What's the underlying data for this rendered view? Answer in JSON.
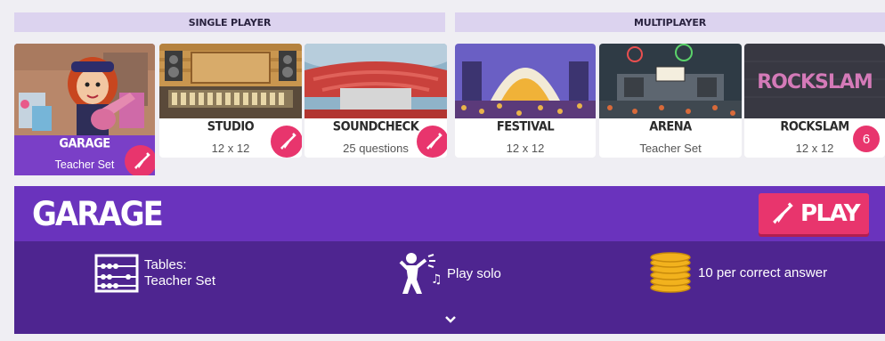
{
  "sections": {
    "single_player": "SINGLE PLAYER",
    "multiplayer": "MULTIPLAYER"
  },
  "cards": {
    "garage": {
      "title": "GARAGE",
      "subtitle": "Teacher Set",
      "icon": "guitar-icon"
    },
    "studio": {
      "title": "STUDIO",
      "subtitle": "12 x 12",
      "icon": "guitar-icon"
    },
    "soundcheck": {
      "title": "SOUNDCHECK",
      "subtitle": "25 questions",
      "icon": "guitar-icon"
    },
    "festival": {
      "title": "FESTIVAL",
      "subtitle": "12 x 12"
    },
    "arena": {
      "title": "ARENA",
      "subtitle": "Teacher Set"
    },
    "rockslam": {
      "title": "ROCKSLAM",
      "subtitle": "12 x 12",
      "badge": "6"
    }
  },
  "rockslam_logo": "ROCKSLAM",
  "banner": {
    "title": "GARAGE",
    "play_label": "PLAY"
  },
  "info": {
    "tables_label": "Tables:",
    "tables_value": "Teacher Set",
    "mode": "Play solo",
    "reward": "10 per correct answer"
  },
  "colors": {
    "accent_pink": "#e8356d",
    "purple": "#6a33bd",
    "dark_purple": "#4e2590",
    "section_header": "#dcd3ef"
  }
}
